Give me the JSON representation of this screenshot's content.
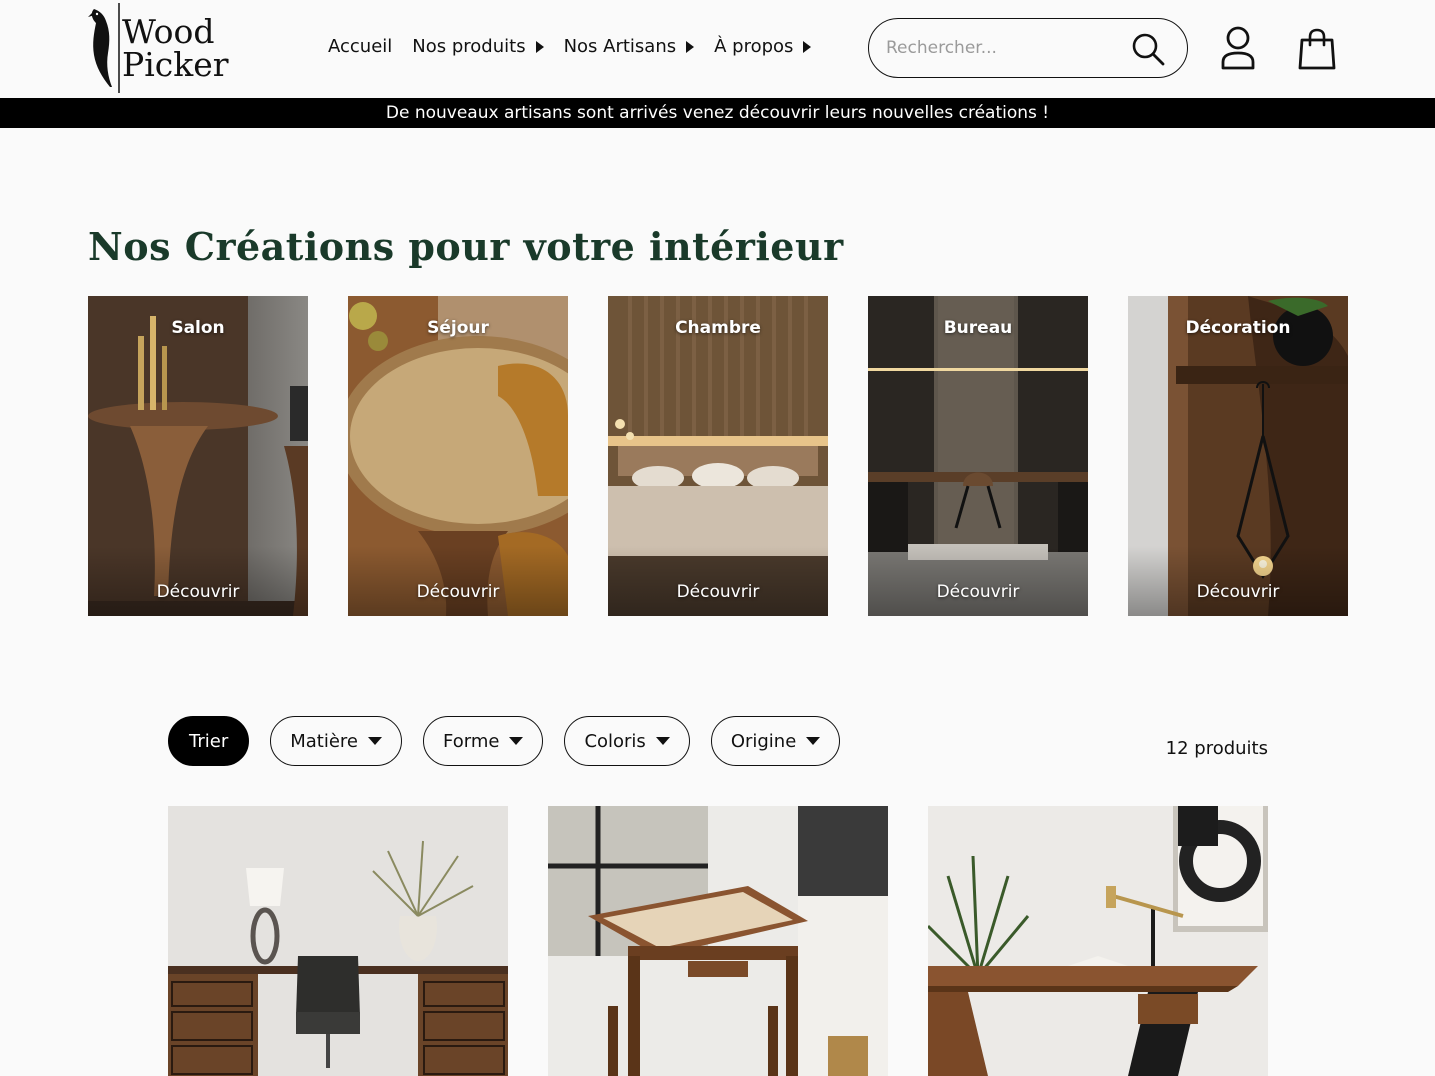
{
  "brand": {
    "line1": "Wood",
    "line2": "Picker"
  },
  "nav": {
    "items": [
      {
        "label": "Accueil",
        "has_submenu": false
      },
      {
        "label": "Nos produits",
        "has_submenu": true
      },
      {
        "label": "Nos Artisans",
        "has_submenu": true
      },
      {
        "label": "À propos",
        "has_submenu": true
      }
    ]
  },
  "search": {
    "placeholder": "Rechercher...",
    "value": ""
  },
  "icons": {
    "search": "search-icon",
    "account": "user-icon",
    "cart": "shopping-bag-icon",
    "caret": "caret-right-icon",
    "dropdown": "caret-down-icon"
  },
  "announcement": "De nouveaux artisans sont arrivés venez découvrir leurs nouvelles créations !",
  "section": {
    "title": "Nos Créations pour votre intérieur"
  },
  "categories": [
    {
      "title": "Salon",
      "cta": "Découvrir"
    },
    {
      "title": "Séjour",
      "cta": "Découvrir"
    },
    {
      "title": "Chambre",
      "cta": "Découvrir"
    },
    {
      "title": "Bureau",
      "cta": "Découvrir"
    },
    {
      "title": "Décoration",
      "cta": "Découvrir"
    }
  ],
  "filters": {
    "sort_label": "Trier",
    "options": [
      "Matière",
      "Forme",
      "Coloris",
      "Origine"
    ]
  },
  "product_count": "12 produits",
  "colors": {
    "accent_title": "#1a3a2a",
    "bar_bg": "#000000",
    "page_bg": "#fafafa"
  }
}
